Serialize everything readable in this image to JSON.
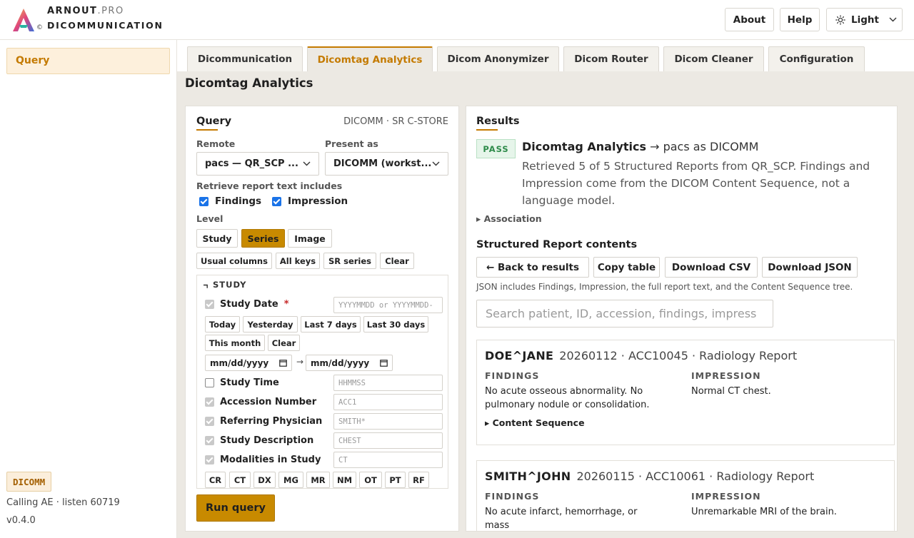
{
  "header": {
    "brand_top": "ARNOUT",
    "brand_suffix": ".PRO",
    "brand_bottom": "DICOMMUNICATION",
    "copyright": "©",
    "buttons": {
      "about": "About",
      "help": "Help",
      "theme": "Light"
    }
  },
  "sidebar": {
    "items": [
      {
        "label": "Query"
      }
    ],
    "ae_title": "DICOMM",
    "calling": "Calling AE · listen 60719",
    "version": "v0.4.0"
  },
  "tabs": [
    {
      "label": "Dicommunication"
    },
    {
      "label": "Dicomtag Analytics"
    },
    {
      "label": "Dicom Anonymizer"
    },
    {
      "label": "Dicom Router"
    },
    {
      "label": "Dicom Cleaner"
    },
    {
      "label": "Configuration"
    }
  ],
  "page_title": "Dicomtag Analytics",
  "query": {
    "title": "Query",
    "meta": "DICOMM · SR C-STORE",
    "remote_label": "Remote",
    "remote_value": "pacs — QR_SCP ...",
    "present_label": "Present as",
    "present_value": "DICOMM (workst...",
    "report_text_label": "Retrieve report text includes",
    "findings": "Findings",
    "impression": "Impression",
    "level_label": "Level",
    "levels": [
      "Study",
      "Series",
      "Image"
    ],
    "presets": [
      "Usual columns",
      "All keys",
      "SR series",
      "Clear"
    ],
    "study_section": "STUDY",
    "study_date": "Study Date",
    "required_mark": "*",
    "study_date_placeholder": "YYYYMMDD or YYYYMMDD-",
    "date_quick": [
      "Today",
      "Yesterday",
      "Last 7 days",
      "Last 30 days",
      "This month",
      "Clear"
    ],
    "date_from": "mm/dd/yyyy",
    "date_arrow": "→",
    "date_to": "mm/dd/yyyy",
    "fields": [
      {
        "label": "Study Time",
        "placeholder": "HHMMSS"
      },
      {
        "label": "Accession Number",
        "placeholder": "ACC1"
      },
      {
        "label": "Referring Physician",
        "placeholder": "SMITH*"
      },
      {
        "label": "Study Description",
        "placeholder": "CHEST"
      },
      {
        "label": "Modalities in Study",
        "placeholder": "CT"
      }
    ],
    "modalities": [
      "CR",
      "CT",
      "DX",
      "MG",
      "MR",
      "NM",
      "OT",
      "PT",
      "RF"
    ],
    "run": "Run query"
  },
  "results": {
    "title": "Results",
    "status": "PASS",
    "headline_bold": "Dicomtag Analytics",
    "headline_rest": " → pacs as DICOMM",
    "description": "Retrieved 5 of 5 Structured Reports from QR_SCP. Findings and Impression come from the DICOM Content Sequence, not a language model.",
    "association": "▸ Association",
    "sr_heading": "Structured Report contents",
    "buttons": [
      "← Back to results",
      "Copy table",
      "Download CSV",
      "Download JSON"
    ],
    "note": "JSON includes Findings, Impression, the full report text, and the Content Sequence tree.",
    "search_placeholder": "Search patient, ID, accession, findings, impress",
    "findings_heading": "FINDINGS",
    "impression_heading": "IMPRESSION",
    "content_sequence": "▸ Content Sequence",
    "reports": [
      {
        "patient": "DOE^JANE",
        "info": "20260112 · ACC10045 · Radiology Report",
        "findings": "No acute osseous abnormality. No pulmonary nodule or consolidation.",
        "impression": "Normal CT chest."
      },
      {
        "patient": "SMITH^JOHN",
        "info": "20260115 · ACC10061 · Radiology Report",
        "findings": "No acute infarct, hemorrhage, or mass",
        "impression": "Unremarkable MRI of the brain."
      }
    ]
  },
  "colors": {
    "accent": "#c47a00",
    "pass": "#2e8b4a",
    "checkbox": "#1a73e8"
  }
}
